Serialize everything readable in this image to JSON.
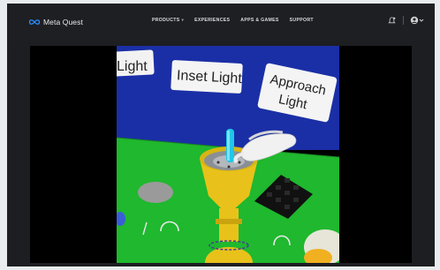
{
  "nav": {
    "brand": "Meta Quest",
    "menu": [
      {
        "label": "PRODUCTS",
        "has_dropdown": true
      },
      {
        "label": "EXPERIENCES",
        "has_dropdown": false
      },
      {
        "label": "APPS & GAMES",
        "has_dropdown": false
      },
      {
        "label": "SUPPORT",
        "has_dropdown": false
      }
    ],
    "icons": [
      "notification-icon",
      "account-icon"
    ]
  },
  "video": {
    "scene_signs": [
      "Light",
      "Inset Light",
      "Approach",
      "Light"
    ]
  },
  "colors": {
    "nav_bg": "#1d1f23",
    "sky": "#1a2fa6",
    "ground": "#1fb82e",
    "fixture": "#e8c21a"
  }
}
